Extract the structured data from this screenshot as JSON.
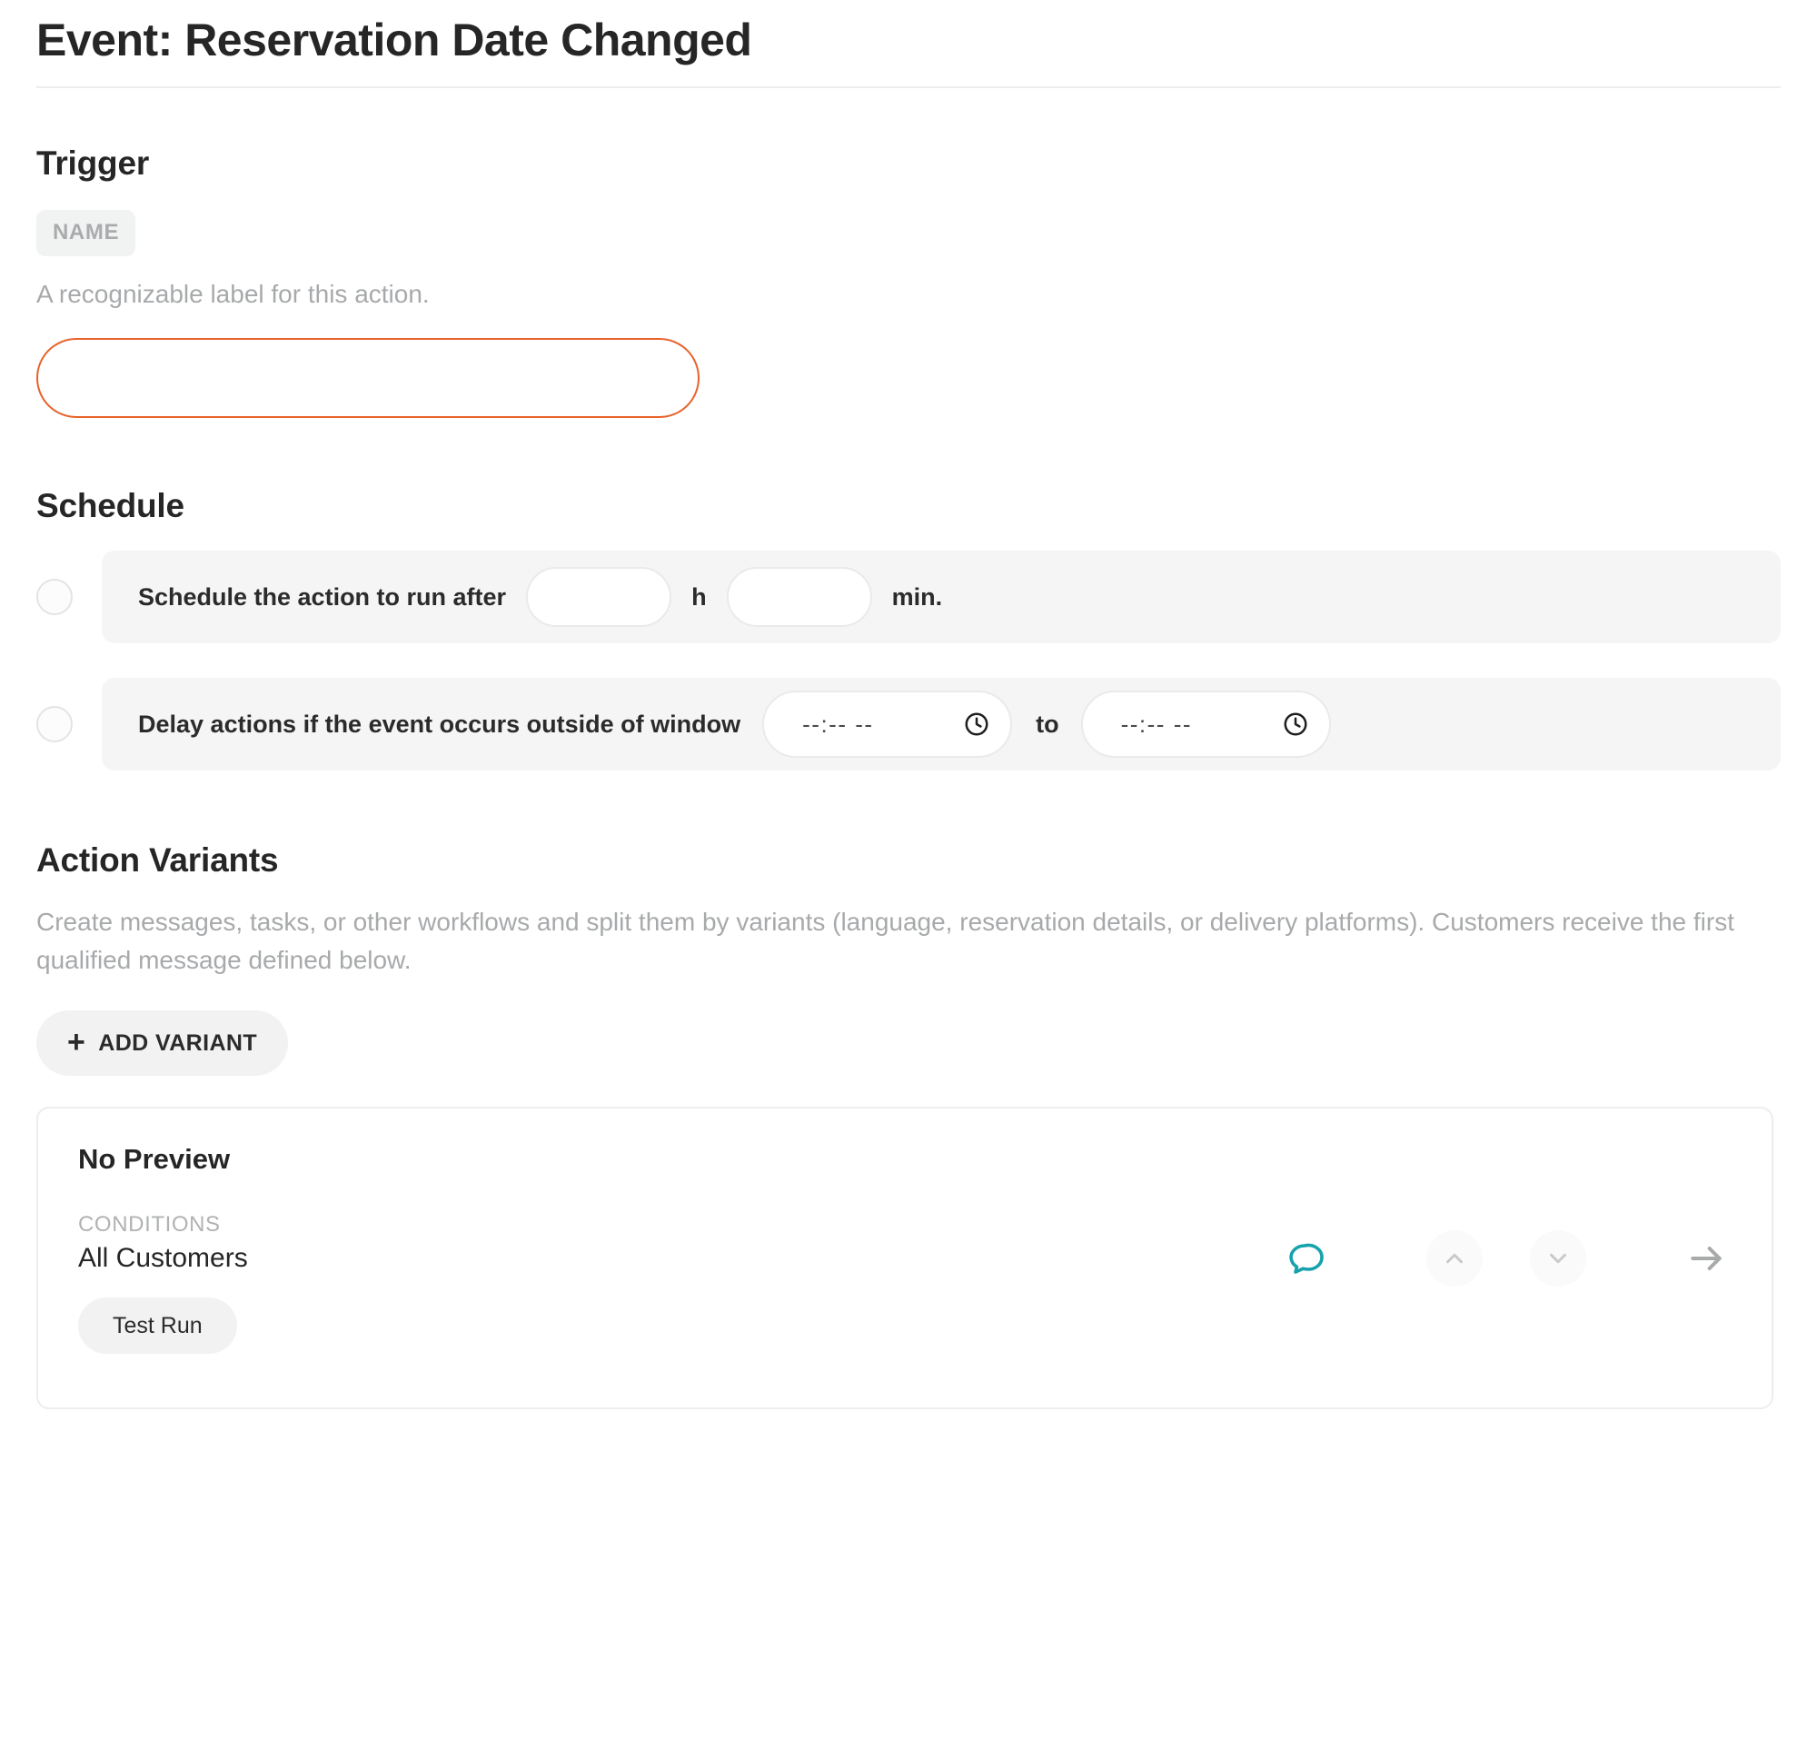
{
  "header": {
    "title": "Event: Reservation Date Changed"
  },
  "trigger": {
    "heading": "Trigger",
    "name_badge": "NAME",
    "helper_text": "A recognizable label for this action.",
    "name_value": "",
    "name_placeholder": "",
    "accent_color": "#e8622a"
  },
  "schedule": {
    "heading": "Schedule",
    "rows": [
      {
        "label": "Schedule the action to run after",
        "hours_value": "",
        "hours_unit": "h",
        "minutes_value": "",
        "minutes_unit": "min.",
        "selected": false,
        "radio_icon": "radio-unchecked-icon"
      },
      {
        "label": "Delay actions if the event occurs outside of window",
        "from_placeholder": "--:-- --",
        "from_value": "",
        "to_label": "to",
        "until_placeholder": "--:-- --",
        "until_value": "",
        "selected": false,
        "radio_icon": "radio-unchecked-icon",
        "time_icon": "clock-icon"
      }
    ]
  },
  "action_variants": {
    "heading": "Action Variants",
    "description": "Create messages, tasks, or other workflows and split them by variants (language, reservation details, or delivery platforms). Customers receive the first qualified message defined below.",
    "add_variant_label": "ADD VARIANT",
    "add_variant_icon": "plus-icon",
    "card": {
      "title": "No Preview",
      "conditions_label": "CONDITIONS",
      "conditions_value": "All Customers",
      "test_run_label": "Test Run",
      "actions": [
        {
          "name": "chat-icon",
          "color": "#17a2ad"
        },
        {
          "name": "chevron-up-icon",
          "color": "#c8c9ca"
        },
        {
          "name": "chevron-down-icon",
          "color": "#c8c9ca"
        },
        {
          "name": "arrow-right-icon",
          "color": "#a8a9aa"
        }
      ]
    }
  }
}
